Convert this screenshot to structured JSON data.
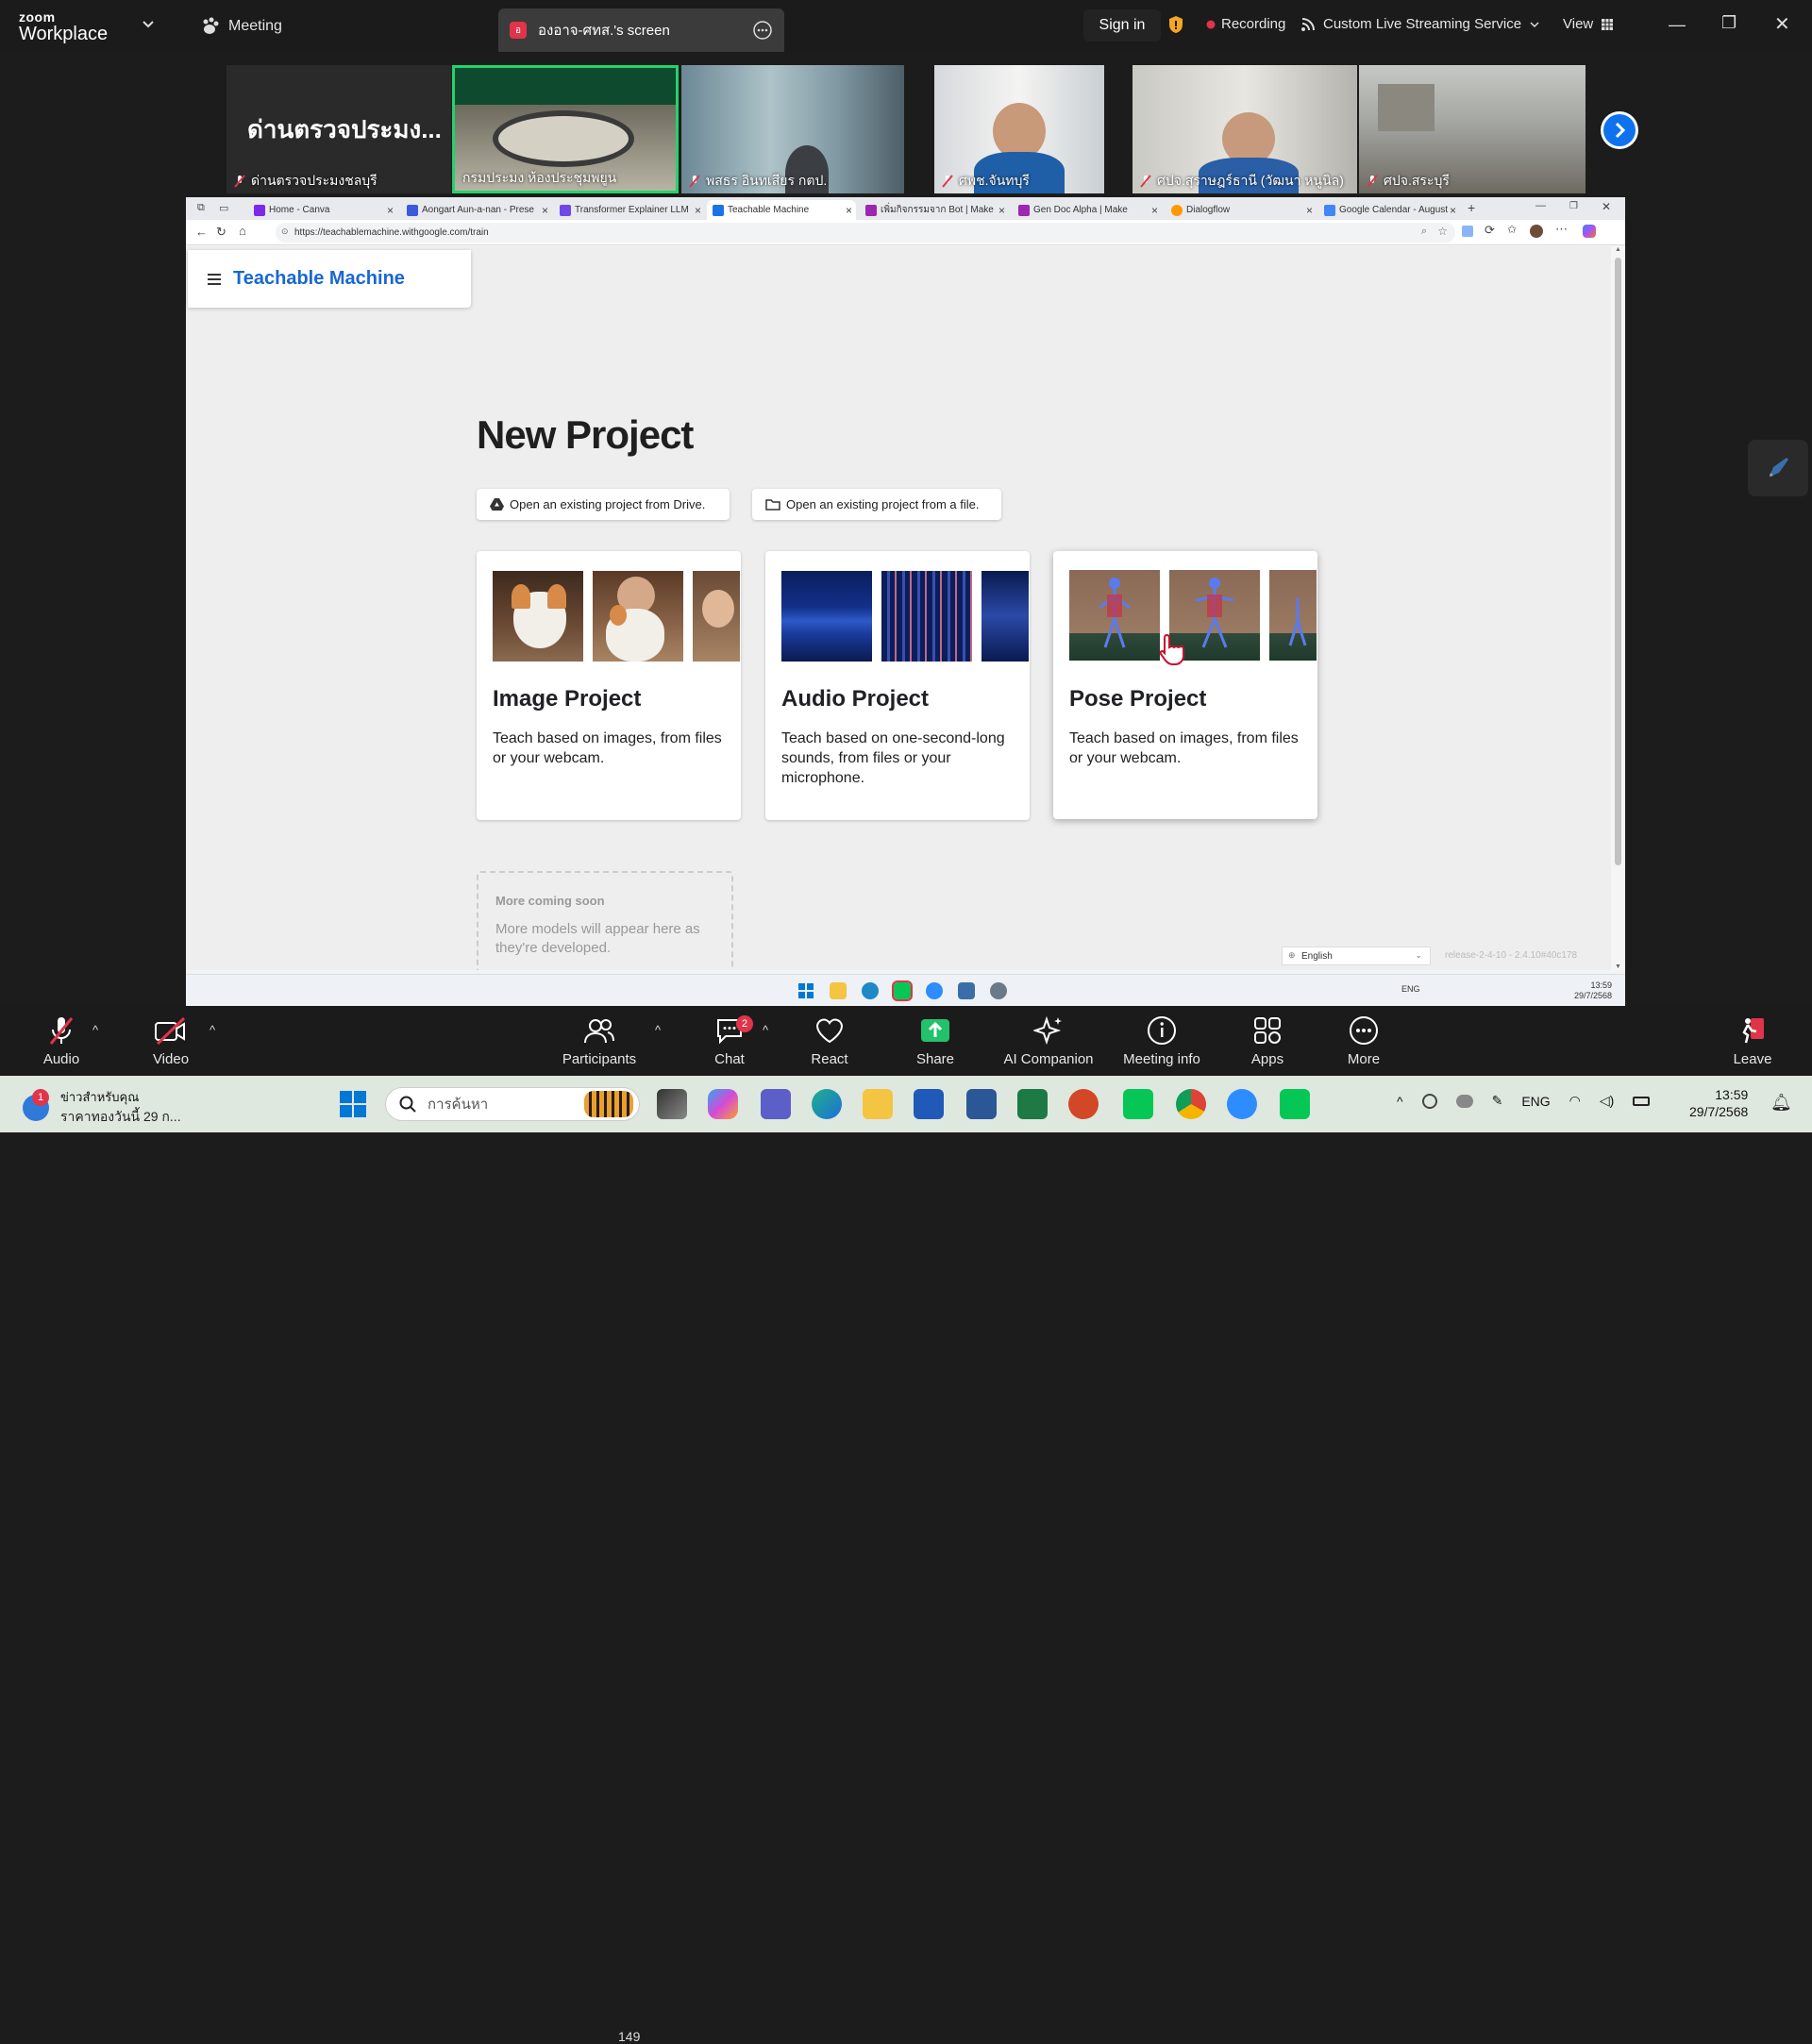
{
  "zoom": {
    "logo_line1": "zoom",
    "logo_line2": "Workplace",
    "meeting_label": "Meeting",
    "screen_tab": "องอาจ-ศทส.'s screen",
    "screen_tab_initial": "อ",
    "sign_in": "Sign in",
    "recording": "Recording",
    "live_stream": "Custom Live Streaming Service",
    "view": "View",
    "accent": "#0e72ed",
    "recording_color": "#e0344a"
  },
  "gallery": {
    "tiles": [
      {
        "name": "ด่านตรวจประมงชลบุรี",
        "big_text": "ด่านตรวจประมง..."
      },
      {
        "name": "กรมประมง ห้องประชุมพยูน"
      },
      {
        "name": "พสธร อินทเสียร กตป."
      },
      {
        "name": "ศพช.จันทบุรี"
      },
      {
        "name": "ศปจ.สุราษฎร์ธานี (วัฒนา หนูนิล)"
      },
      {
        "name": "ศปจ.สระบุรี"
      }
    ]
  },
  "browser": {
    "tabs": [
      {
        "label": "Home - Canva",
        "favicon_color": "#7d2ae8"
      },
      {
        "label": "Aongart Aun-a-nan - Prese",
        "favicon_color": "#3b5bdb"
      },
      {
        "label": "Transformer Explainer LLM",
        "favicon_color": "#7048e8"
      },
      {
        "label": "Teachable Machine",
        "favicon_color": "#1a73e8",
        "active": true
      },
      {
        "label": "เพิ่มกิจกรรมจาก Bot | Make",
        "favicon_color": "#9c27b0"
      },
      {
        "label": "Gen Doc Alpha | Make",
        "favicon_color": "#9c27b0"
      },
      {
        "label": "Dialogflow",
        "favicon_color": "#ff9800"
      },
      {
        "label": "Google Calendar - August",
        "favicon_color": "#4285f4"
      }
    ],
    "url": "https://teachablemachine.withgoogle.com/train"
  },
  "teachable": {
    "title": "Teachable Machine",
    "page_title": "New Project",
    "open_drive": "Open an existing project from Drive.",
    "open_file": "Open an existing project from a file.",
    "cards": [
      {
        "title": "Image Project",
        "desc": "Teach based on images, from files or your webcam."
      },
      {
        "title": "Audio Project",
        "desc": "Teach based on one-second-long sounds, from files or your microphone."
      },
      {
        "title": "Pose Project",
        "desc": "Teach based on images, from files or your webcam."
      }
    ],
    "coming_soon_title": "More coming soon",
    "coming_soon_desc": "More models will appear here as they're developed.",
    "language": "English",
    "release": "release-2-4-10 - 2.4.10#40c178"
  },
  "remote_taskbar": {
    "time": "13:59",
    "date": "29/7/2568",
    "lang": "ENG"
  },
  "controls": {
    "audio": "Audio",
    "video": "Video",
    "participants": "Participants",
    "participants_count": "149",
    "chat": "Chat",
    "chat_badge": "2",
    "react": "React",
    "share": "Share",
    "ai": "AI Companion",
    "info": "Meeting info",
    "apps": "Apps",
    "more": "More",
    "leave": "Leave",
    "share_color": "#23c16b"
  },
  "taskbar": {
    "news_badge": "1",
    "news_title": "ข่าวสำหรับคุณ",
    "news_sub": "ราคาทองวันนี้ 29 ก...",
    "search_placeholder": "การค้นหา",
    "lang": "ENG",
    "time": "13:59",
    "date": "29/7/2568"
  }
}
